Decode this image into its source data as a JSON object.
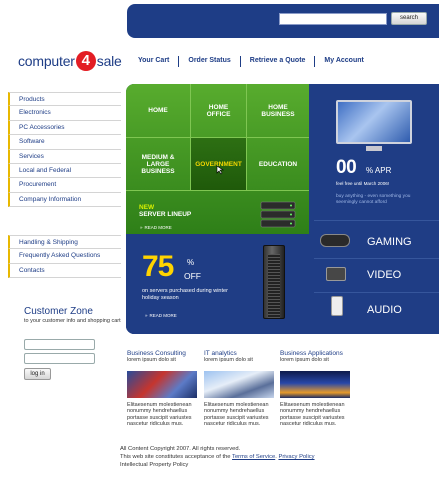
{
  "search": {
    "button_label": "search",
    "placeholder": ""
  },
  "logo": {
    "part1": "computer",
    "num": "4",
    "part2": "sale"
  },
  "topnav": [
    "Your Cart",
    "Order Status",
    "Retrieve a Quote",
    "My Account"
  ],
  "leftnav": {
    "group1": [
      "Products",
      "Electronics",
      "PC Accessories",
      "Software",
      "Services",
      "Local and Federal",
      "Procurement",
      "Company Information"
    ],
    "group2": [
      "Handling & Shipping",
      "Frequently Asked Questions",
      "Contacts"
    ]
  },
  "customer_zone": {
    "title": "Customer Zone",
    "subtitle": "to your customer info and shopping cart",
    "login_label": "log in"
  },
  "categories": {
    "home": "HOME",
    "home_office": "HOME OFFICE",
    "home_business": "HOME BUSINESS",
    "medium_large": "MEDIUM & LARGE BUSINESS",
    "government": "GOVERNMENT",
    "education": "EDUCATION"
  },
  "server_promo": {
    "line1": "NEW",
    "line2": "SERVER LINEUP",
    "read_more": "READ MORE"
  },
  "discount": {
    "value": "75",
    "sign": "%",
    "off": "OFF",
    "desc": "on servers purchased during winter holiday season",
    "read_more": "READ MORE"
  },
  "apr": {
    "big": "00",
    "pct": "% APR",
    "line": "feel free until March 2006!",
    "desc": "buy anything - even something you seemingly cannot afford"
  },
  "media": {
    "gaming": "GAMING",
    "video": "VIDEO",
    "audio": "AUDIO"
  },
  "sections": [
    {
      "title": "Business Consulting",
      "sub": "lorem ipsum dolo sit",
      "text": "Elitaesenum molestienean nonummy hendrehaellus portasse suscipit variustes nascetur ridiculus mus."
    },
    {
      "title": "IT analytics",
      "sub": "lorem ipsum dolo sit",
      "text": "Elitaesenum molestienean nonummy hendrehaellus portasse suscipit variustes nascetur ridiculus mus."
    },
    {
      "title": "Business Applications",
      "sub": "lorem ipsum dolo sit",
      "text": "Elitaesenum molestienean nonummy hendrehaellus portasse suscipit variustes nascetur ridiculus mus."
    }
  ],
  "footer": {
    "line1": "All Content Copyright 2007. All rights reserved.",
    "line2_pre": "This web site constitutes acceptance of the",
    "tos": "Terms of Service",
    "privacy": "Privacy Policy",
    "ip": "Intellectual Property Policy"
  },
  "colors": {
    "brand_blue": "#1e3d86",
    "green": "#4a9e26",
    "yellow": "#f5d800",
    "red": "#e31d24"
  }
}
